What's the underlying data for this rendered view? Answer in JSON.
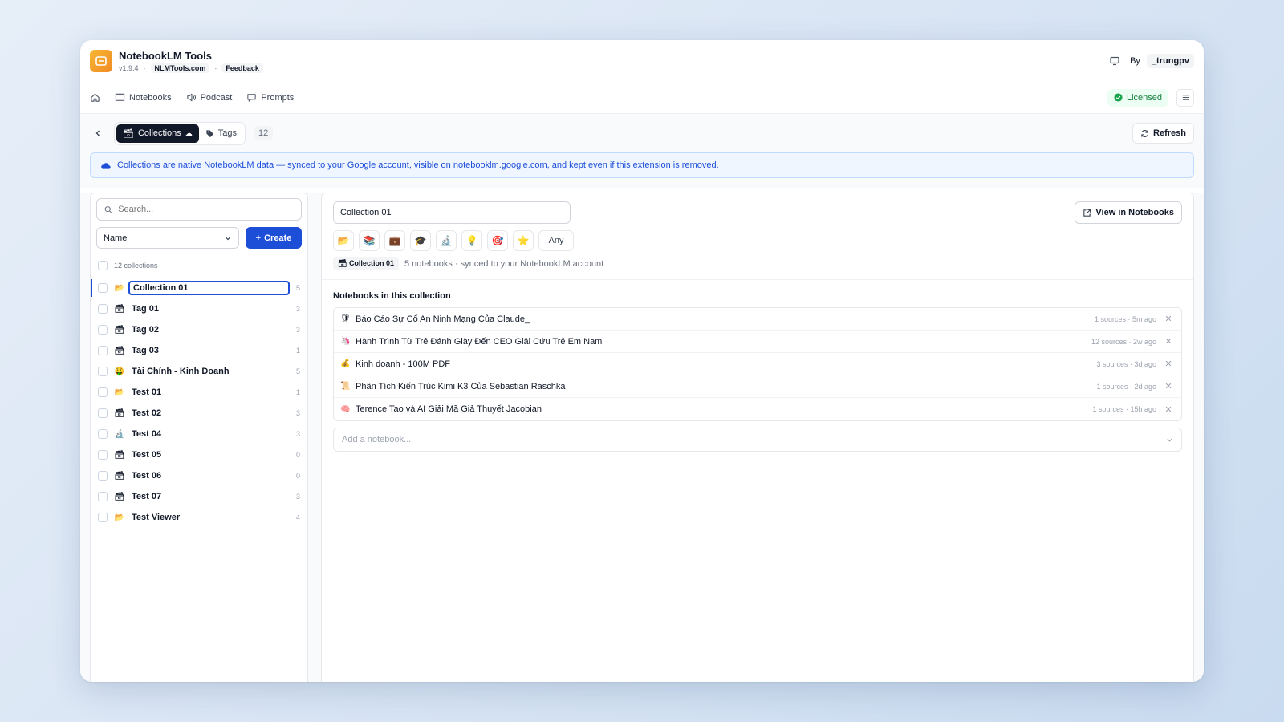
{
  "app": {
    "title": "NotebookLM Tools",
    "version": "v1.9.4",
    "site": "NLMTools.com",
    "feedback": "Feedback",
    "by_label": "By",
    "author": "_trungpv"
  },
  "nav": {
    "items": [
      {
        "label": "Notebooks",
        "icon": "book-icon"
      },
      {
        "label": "Podcast",
        "icon": "speaker-icon"
      },
      {
        "label": "Prompts",
        "icon": "chat-bubble-icon"
      }
    ],
    "license_label": "Licensed"
  },
  "toolbar": {
    "tab_collections": "Collections",
    "tab_tags": "Tags",
    "count": "12",
    "refresh_label": "Refresh"
  },
  "banner": {
    "text": "Collections are native NotebookLM data — synced to your Google account, visible on notebooklm.google.com, and kept even if this extension is removed."
  },
  "sidebar": {
    "search_placeholder": "Search...",
    "sort_value": "Name",
    "create_label": "Create",
    "total_label": "12 collections",
    "collections": [
      {
        "icon": "📂",
        "name": "Collection 01",
        "count": "5",
        "active": true
      },
      {
        "icon": "🗃",
        "name": "Tag 01",
        "count": "3"
      },
      {
        "icon": "🗃",
        "name": "Tag 02",
        "count": "3"
      },
      {
        "icon": "🗃",
        "name": "Tag 03",
        "count": "1"
      },
      {
        "icon": "🤑",
        "name": "Tài Chính - Kinh Doanh",
        "count": "5"
      },
      {
        "icon": "📂",
        "name": "Test 01",
        "count": "1"
      },
      {
        "icon": "🗃",
        "name": "Test 02",
        "count": "3"
      },
      {
        "icon": "🔬",
        "name": "Test 04",
        "count": "3"
      },
      {
        "icon": "🗃",
        "name": "Test 05",
        "count": "0"
      },
      {
        "icon": "🗃",
        "name": "Test 06",
        "count": "0"
      },
      {
        "icon": "🗃",
        "name": "Test 07",
        "count": "3"
      },
      {
        "icon": "📂",
        "name": "Test Viewer",
        "count": "4"
      }
    ]
  },
  "detail": {
    "name_value": "Collection 01",
    "view_label": "View in Notebooks",
    "icon_options": [
      "📂",
      "📚",
      "💼",
      "🎓",
      "🔬",
      "💡",
      "🎯",
      "⭐"
    ],
    "any_label": "Any",
    "chip_label": "Collection 01",
    "summary": "5 notebooks · synced to your NotebookLM account",
    "section_title": "Notebooks in this collection",
    "notebooks": [
      {
        "icon": "🛡",
        "title": "Báo Cáo Sự Cố An Ninh Mạng Của Claude_",
        "meta": "1 sources · 5m ago"
      },
      {
        "icon": "🦄",
        "title": "Hành Trình Từ Trẻ Đánh Giày Đến CEO Giải Cứu Trẻ Em Nam",
        "meta": "12 sources · 2w ago"
      },
      {
        "icon": "💰",
        "title": "Kinh doanh - 100M PDF",
        "meta": "3 sources · 3d ago"
      },
      {
        "icon": "📜",
        "title": "Phân Tích Kiến Trúc Kimi K3 Của Sebastian Raschka",
        "meta": "1 sources · 2d ago"
      },
      {
        "icon": "🧠",
        "title": "Terence Tao và AI Giải Mã Giả Thuyết Jacobian",
        "meta": "1 sources · 15h ago"
      }
    ],
    "add_placeholder": "Add a notebook..."
  },
  "colors": {
    "accent": "#1d4ed8",
    "license_green": "#15803d"
  }
}
